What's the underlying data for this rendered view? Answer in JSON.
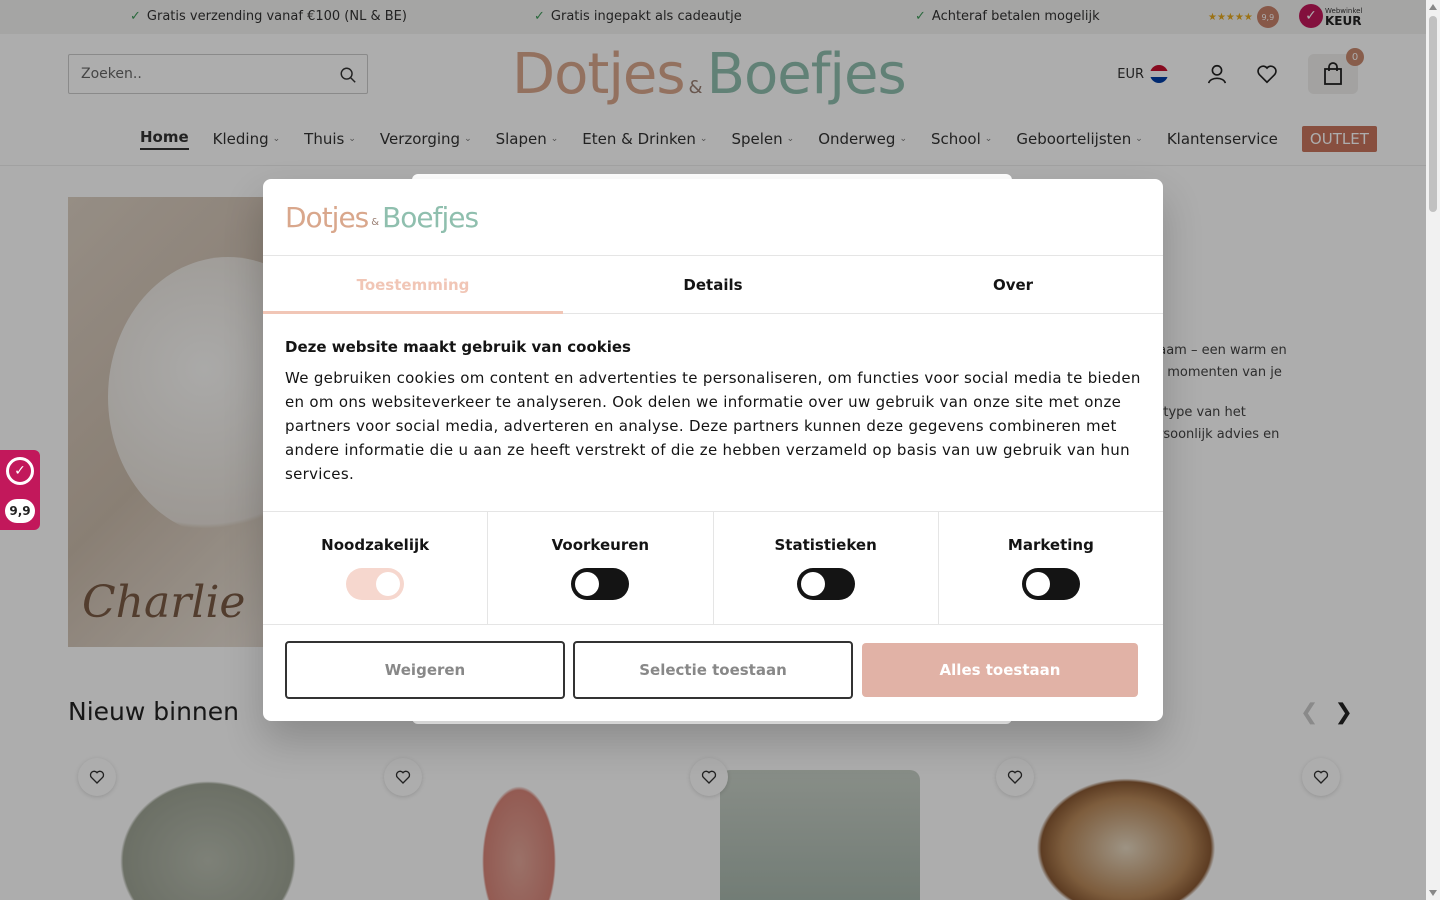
{
  "topbar": {
    "usps": [
      "Gratis verzending vanaf €100 (NL & BE)",
      "Gratis ingepakt als cadeautje",
      "Achteraf betalen mogelijk"
    ],
    "rating_score": "9,9",
    "keur_small": "Webwinkel",
    "keur_big": "KEUR"
  },
  "header": {
    "search_placeholder": "Zoeken..",
    "logo_word1": "Dotjes",
    "logo_amp": "&",
    "logo_word2": "Boefjes",
    "currency": "EUR",
    "cart_count": "0"
  },
  "nav": {
    "items": [
      {
        "label": "Home",
        "active": true
      },
      {
        "label": "Kleding"
      },
      {
        "label": "Thuis"
      },
      {
        "label": "Verzorging"
      },
      {
        "label": "Slapen"
      },
      {
        "label": "Eten & Drinken"
      },
      {
        "label": "Spelen"
      },
      {
        "label": "Onderweg"
      },
      {
        "label": "School"
      },
      {
        "label": "Geboortelijsten"
      },
      {
        "label": "Klantenservice"
      },
      {
        "label": "OUTLET"
      }
    ]
  },
  "hero": {
    "name_text": "Charlie",
    "text_line1": "naam – een warm en",
    "text_line2": "te momenten van je",
    "text_line3": "ertype van het",
    "text_line4": "ersoonlijk advies en"
  },
  "section": {
    "title": "Nieuw binnen"
  },
  "side_rating": {
    "score": "9,9"
  },
  "cookie_dialog": {
    "logo_word1": "Dotjes",
    "logo_amp": "&",
    "logo_word2": "Boefjes",
    "tabs": [
      "Toestemming",
      "Details",
      "Over"
    ],
    "heading": "Deze website maakt gebruik van cookies",
    "body": "We gebruiken cookies om content en advertenties te personaliseren, om functies voor social media te bieden en om ons websiteverkeer te analyseren. Ook delen we informatie over uw gebruik van onze site met onze partners voor social media, adverteren en analyse. Deze partners kunnen deze gegevens combineren met andere informatie die u aan ze heeft verstrekt of die ze hebben verzameld op basis van uw gebruik van hun services.",
    "toggles": [
      {
        "label": "Noodzakelijk",
        "on": true
      },
      {
        "label": "Voorkeuren",
        "on": false
      },
      {
        "label": "Statistieken",
        "on": false
      },
      {
        "label": "Marketing",
        "on": false
      }
    ],
    "buttons": {
      "reject": "Weigeren",
      "allow_selection": "Selectie toestaan",
      "allow_all": "Alles toestaan"
    }
  },
  "colors": {
    "accent": "#e1b2a6",
    "tab_active": "#f1c6b6",
    "outlet": "#c9755d",
    "keur": "#c2185b"
  }
}
